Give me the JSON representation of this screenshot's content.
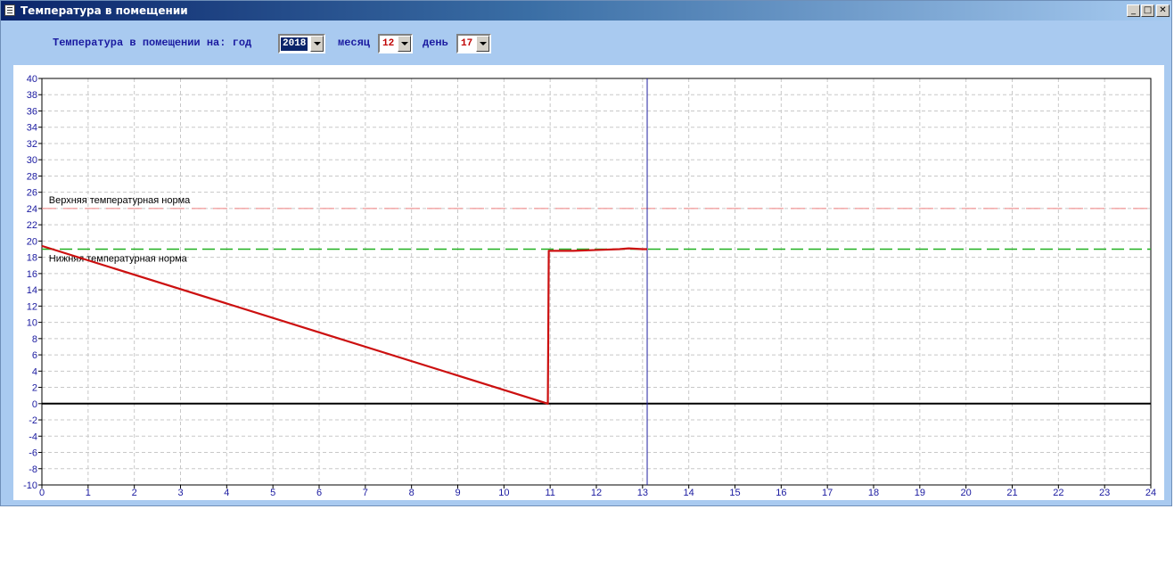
{
  "window": {
    "title": "Температура в помещении"
  },
  "window_controls": {
    "minimize": "_",
    "maximize": "□",
    "close": "✕"
  },
  "toolbar": {
    "prompt_label": "Температура в помещении на: год",
    "year_value": "2018",
    "month_label": "месяц",
    "month_value": "12",
    "day_label": "день",
    "day_value": "17"
  },
  "colors": {
    "window_bg": "#a9caf0",
    "plot_grid": "#c8c8c8",
    "axis_labels": "#1a1aa0",
    "temperature_line": "#cc1010",
    "upper_norm_line": "#f08080",
    "lower_norm_line": "#20b020",
    "cursor_line": "#2020a0"
  },
  "chart_data": {
    "type": "line",
    "xlim": [
      0,
      24
    ],
    "ylim": [
      -10,
      40
    ],
    "xticks": [
      0,
      1,
      2,
      3,
      4,
      5,
      6,
      7,
      8,
      9,
      10,
      11,
      12,
      13,
      14,
      15,
      16,
      17,
      18,
      19,
      20,
      21,
      22,
      23,
      24
    ],
    "yticks": [
      -10,
      -8,
      -6,
      -4,
      -2,
      0,
      2,
      4,
      6,
      8,
      10,
      12,
      14,
      16,
      18,
      20,
      22,
      24,
      26,
      28,
      30,
      32,
      34,
      36,
      38,
      40
    ],
    "grid": true,
    "series": [
      {
        "x": [
          0,
          10.95,
          10.97,
          11.5,
          12.0,
          12.5,
          12.7,
          13.0,
          13.1
        ],
        "y": [
          19.4,
          0.0,
          18.8,
          18.8,
          18.9,
          19.0,
          19.1,
          19.0,
          19.0
        ]
      }
    ],
    "reference_lines": [
      {
        "name": "Верхняя температурная норма",
        "y": 24,
        "label_x": 0.15
      },
      {
        "name": "Нижняя температурная норма",
        "y": 19,
        "label_x": 0.15
      }
    ],
    "cursor_x": 13.1
  }
}
